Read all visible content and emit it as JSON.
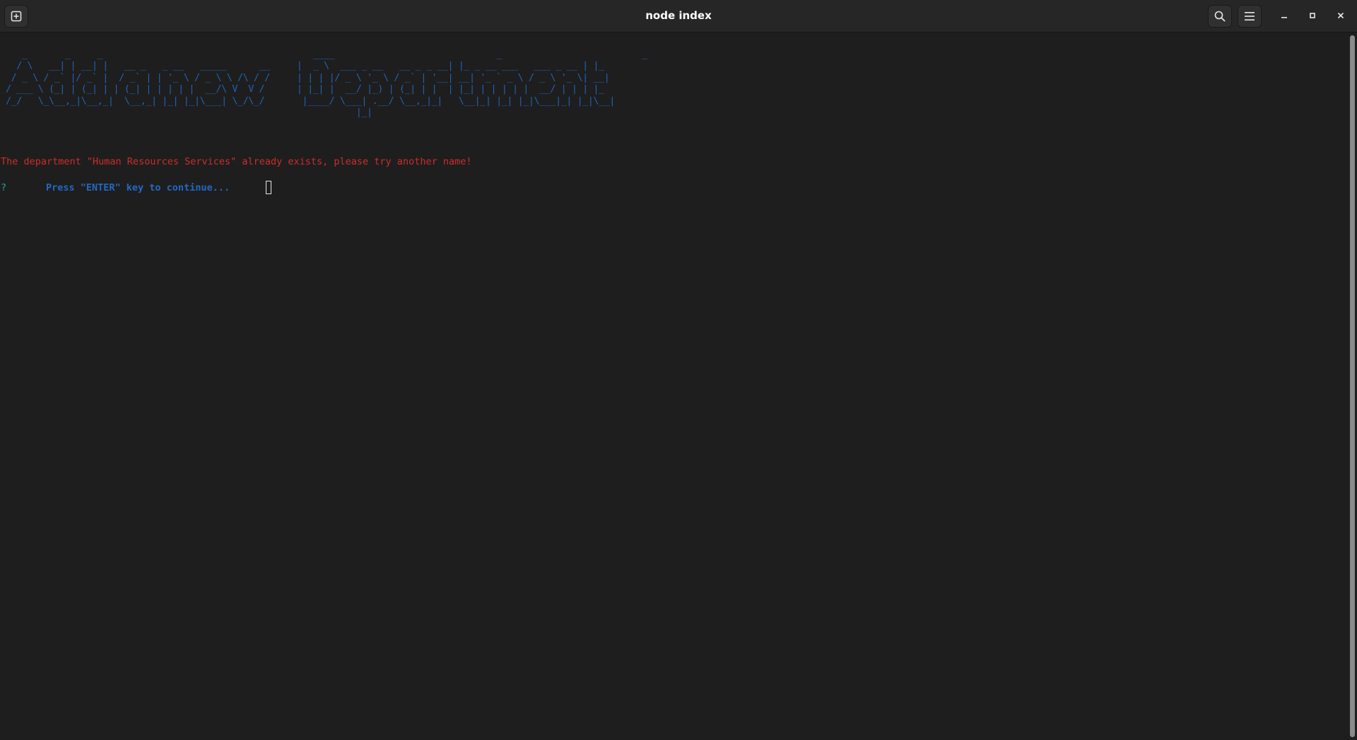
{
  "window": {
    "title": "node index"
  },
  "header": {
    "new_tab_icon": "new-tab-icon",
    "search_icon": "search-icon",
    "menu_icon": "hamburger-menu-icon",
    "minimize_icon": "minimize-icon",
    "maximize_icon": "maximize-icon",
    "close_icon": "close-icon"
  },
  "terminal": {
    "banner": "   _       _     _                                       ____                              _                          _   \n  / \\   __| | __| |   __ _   _ __   _____      __     |  _ \\  ___ _ __   __ _ _ __| |_ _ __ ___   ___ _ __ | |_ \n / _ \\ / _` |/ _` |  / _` | | '_ \\ / _ \\ \\ /\\ / /     | | | |/ _ \\ '_ \\ / _` | '__| __| '_ ` _ \\ / _ \\ '_ \\| __|\n/ ___ \\ (_| | (_| | | (_| | | | | |  __/\\ V  V /      | |_| |  __/ |_) | (_| | |  | |_| | | | | |  __/ | | | |_ \n/_/   \\_\\__,_|\\__,_|  \\__,_| |_| |_|\\___| \\_/\\_/       |____/ \\___| .__/ \\__,_|_|   \\__|_| |_| |_|\\___|_| |_|\\__|\n                                                                 |_|                                               ",
    "error_message": "The department \"Human Resources Services\" already exists, please try another name!",
    "prompt_mark": "?",
    "prompt_text": "Press \"ENTER\" key to continue..."
  },
  "colors": {
    "background": "#1e1e1e",
    "headerbar": "#262626",
    "banner": "#1f63b6",
    "error": "#d02c2c",
    "prompt_mark": "#20a39e",
    "prompt_text": "#2368c2"
  }
}
